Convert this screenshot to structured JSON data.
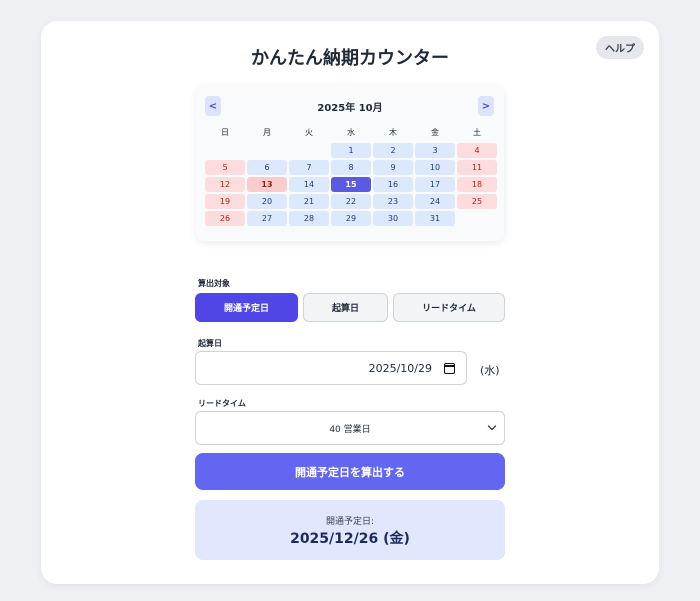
{
  "header": {
    "title": "かんたん納期カウンター",
    "help_label": "ヘルプ"
  },
  "calendar": {
    "month_label": "2025年 10月",
    "prev_label": "<",
    "next_label": ">",
    "weekdays": [
      "日",
      "月",
      "火",
      "水",
      "木",
      "金",
      "土"
    ],
    "lead_blanks": 3,
    "days": [
      {
        "d": "1",
        "t": "normal"
      },
      {
        "d": "2",
        "t": "normal"
      },
      {
        "d": "3",
        "t": "normal"
      },
      {
        "d": "4",
        "t": "holiday"
      },
      {
        "d": "5",
        "t": "holiday"
      },
      {
        "d": "6",
        "t": "normal"
      },
      {
        "d": "7",
        "t": "normal"
      },
      {
        "d": "8",
        "t": "normal"
      },
      {
        "d": "9",
        "t": "normal"
      },
      {
        "d": "10",
        "t": "normal"
      },
      {
        "d": "11",
        "t": "holiday"
      },
      {
        "d": "12",
        "t": "holiday"
      },
      {
        "d": "13",
        "t": "marked"
      },
      {
        "d": "14",
        "t": "normal"
      },
      {
        "d": "15",
        "t": "selected"
      },
      {
        "d": "16",
        "t": "normal"
      },
      {
        "d": "17",
        "t": "normal"
      },
      {
        "d": "18",
        "t": "holiday"
      },
      {
        "d": "19",
        "t": "holiday"
      },
      {
        "d": "20",
        "t": "normal"
      },
      {
        "d": "21",
        "t": "normal"
      },
      {
        "d": "22",
        "t": "normal"
      },
      {
        "d": "23",
        "t": "normal"
      },
      {
        "d": "24",
        "t": "normal"
      },
      {
        "d": "25",
        "t": "holiday"
      },
      {
        "d": "26",
        "t": "holiday"
      },
      {
        "d": "27",
        "t": "normal"
      },
      {
        "d": "28",
        "t": "normal"
      },
      {
        "d": "29",
        "t": "normal"
      },
      {
        "d": "30",
        "t": "normal"
      },
      {
        "d": "31",
        "t": "normal"
      }
    ]
  },
  "form": {
    "target_label": "算出対象",
    "target_options": [
      "開通予定日",
      "起算日",
      "リードタイム"
    ],
    "target_selected": 0,
    "start_label": "起算日",
    "start_value": "2025/10/29",
    "start_weekday": "(水)",
    "lead_label": "リードタイム",
    "lead_value": "40 営業日",
    "calc_button": "開通予定日を算出する"
  },
  "result": {
    "label": "開通予定日:",
    "value": "2025/12/26 (金)"
  },
  "colors": {
    "accent": "#4f46e5",
    "button": "#6366f1",
    "weekday_cell": "#dce8fb",
    "holiday_cell": "#fcdcdc",
    "result_bg": "#e0e7ff"
  }
}
